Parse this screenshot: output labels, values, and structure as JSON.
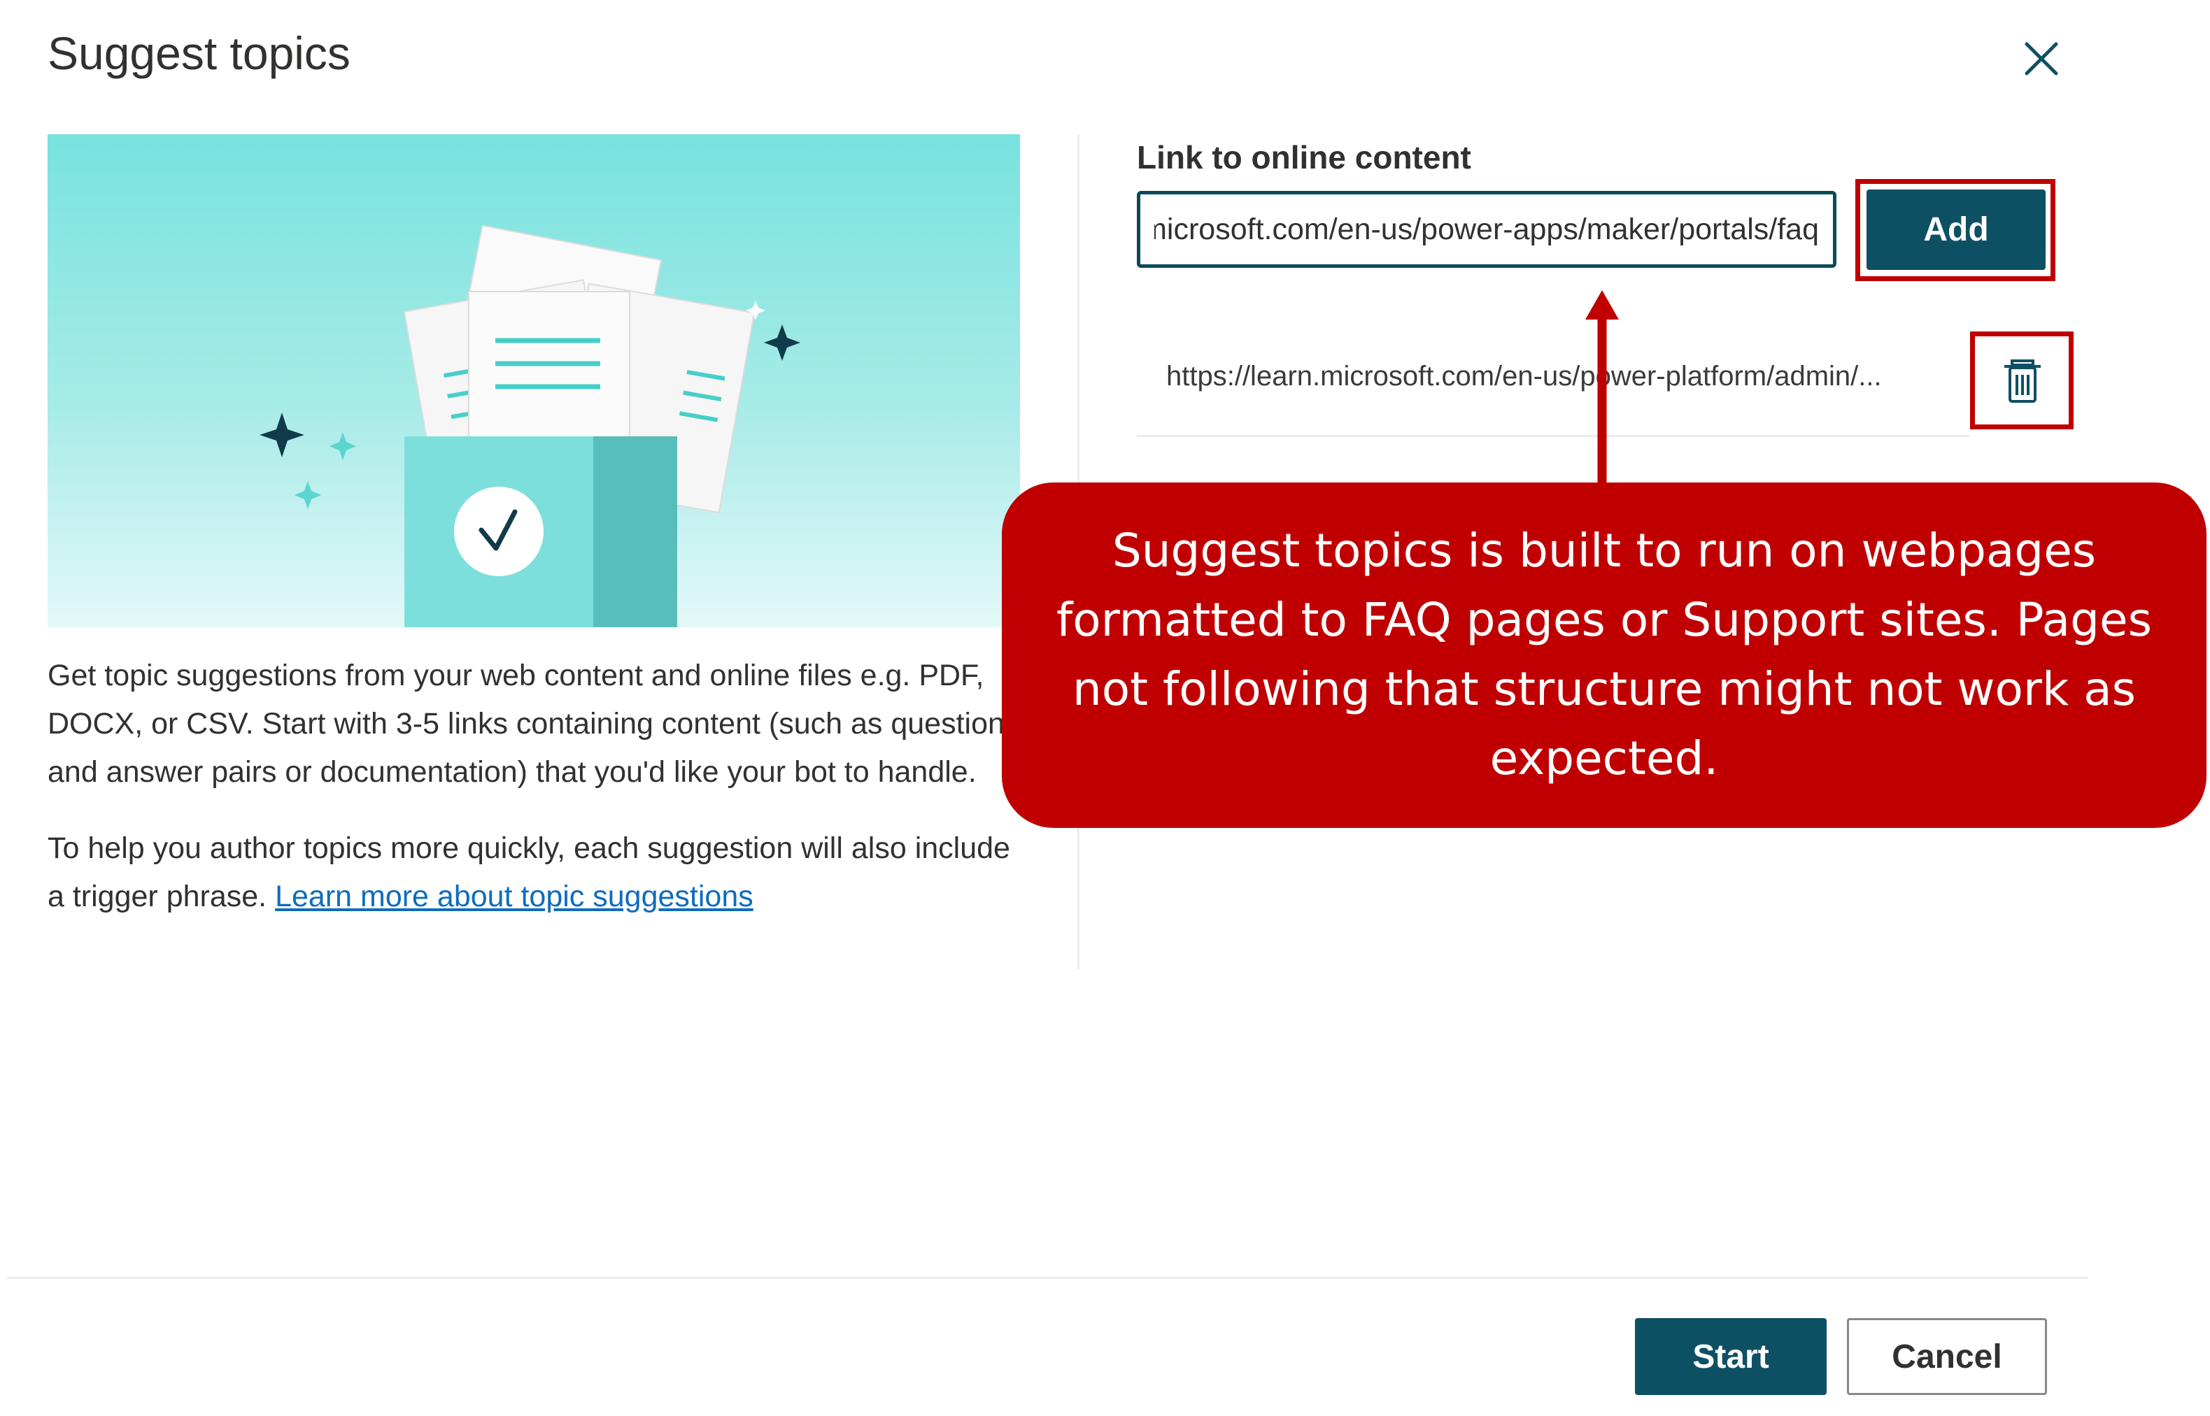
{
  "dialog": {
    "title": "Suggest topics",
    "close_icon": "close-icon"
  },
  "left_panel": {
    "illustration": "documents-box-checkmark-illustration",
    "description": "Get topic suggestions from your web content and online files e.g. PDF, DOCX, or CSV. Start with 3-5 links containing content (such as question and answer pairs or documentation) that you'd like your bot to handle.",
    "helper_text": "To help you author topics more quickly, each suggestion will also include a trigger phrase.",
    "learn_more_link": "Learn more about topic suggestions"
  },
  "right_panel": {
    "link_label": "Link to online content",
    "link_input_value": "https://learn.microsoft.com/en-us/power-apps/maker/portals/faq",
    "add_button": "Add",
    "added_links": [
      {
        "url": "https://learn.microsoft.com/en-us/power-platform/admin/...",
        "delete_icon": "trash-icon"
      }
    ]
  },
  "annotation": {
    "callout_text": "Suggest topics is built to run on webpages formatted to FAQ pages or Support sites.  Pages not following that structure might not work as expected.",
    "callout_color": "#c00000",
    "highlight_color": "#c00000"
  },
  "footer": {
    "start_button": "Start",
    "cancel_button": "Cancel"
  },
  "colors": {
    "primary": "#0e5063",
    "link": "#0f6cbd",
    "illustration_teal": "#78e2de"
  }
}
